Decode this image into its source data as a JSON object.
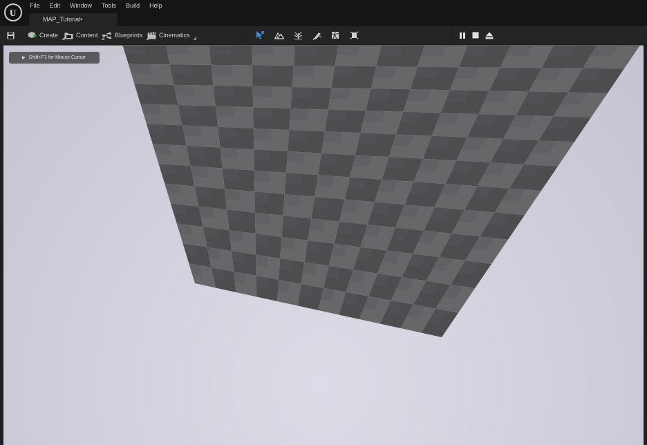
{
  "app": {
    "logo_icon": "unreal-logo-icon"
  },
  "menu": {
    "items": [
      "File",
      "Edit",
      "Window",
      "Tools",
      "Build",
      "Help"
    ]
  },
  "document_tab": {
    "title": "MAP_Tutorial•"
  },
  "toolbar": {
    "save_icon": "save-icon",
    "create_label": "Create",
    "content_label": "Content",
    "blueprints_label": "Blueprints",
    "cinematics_label": "Cinematics",
    "mode_icons": [
      "select-mode-icon",
      "landscape-mode-icon",
      "foliage-mode-icon",
      "mesh-paint-mode-icon",
      "fracture-mode-icon",
      "brush-edit-mode-icon"
    ],
    "play_controls": [
      "pause-icon",
      "stop-icon",
      "eject-icon"
    ]
  },
  "viewport": {
    "hint_text": "Shift+F1 for Mouse Cursor",
    "floor": {
      "dark": "#4d4d50",
      "light": "#67676a",
      "accent": "#3d7dbf"
    }
  }
}
